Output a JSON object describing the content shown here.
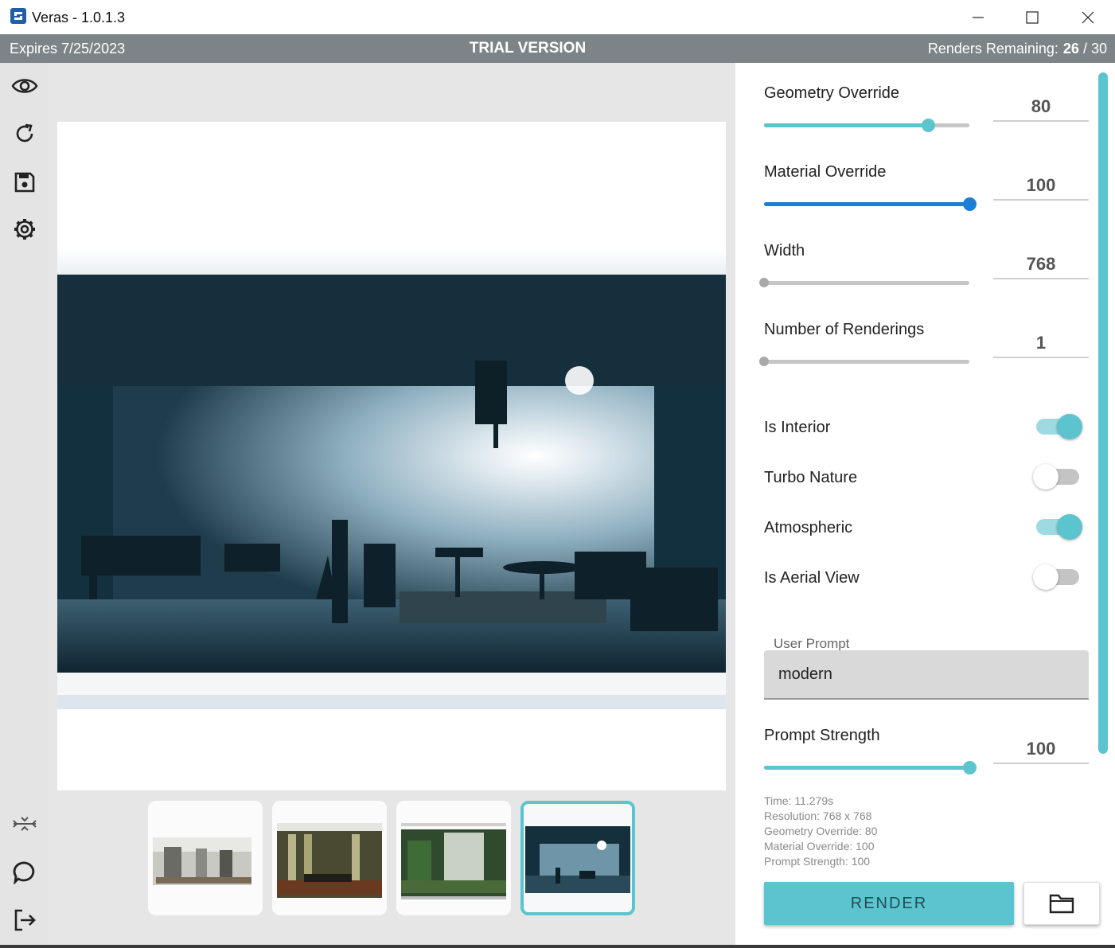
{
  "window": {
    "title": "Veras - 1.0.1.3"
  },
  "trial_bar": {
    "expires": "Expires 7/25/2023",
    "trial_label": "TRIAL VERSION",
    "remaining_label": "Renders Remaining:",
    "remaining_count": "26",
    "remaining_total": "/ 30"
  },
  "sidebar": {
    "top_icons": [
      "eye-icon",
      "refresh-icon",
      "save-icon",
      "gear-icon"
    ],
    "bottom_icons": [
      "collapse-icon",
      "chat-icon",
      "logout-icon"
    ]
  },
  "sliders": {
    "geometry": {
      "label": "Geometry Override",
      "value": "80",
      "fraction": 0.8,
      "color": "#5bc4cf"
    },
    "material": {
      "label": "Material Override",
      "value": "100",
      "fraction": 1.0,
      "color": "#1b7fd6"
    },
    "width": {
      "label": "Width",
      "value": "768",
      "fraction": 0.0,
      "color": "#c6c6c6"
    },
    "renderings": {
      "label": "Number of Renderings",
      "value": "1",
      "fraction": 0.0,
      "color": "#c6c6c6"
    },
    "strength": {
      "label": "Prompt Strength",
      "value": "100",
      "fraction": 1.0,
      "color": "#5bc4cf"
    }
  },
  "toggles": {
    "interior": {
      "label": "Is Interior",
      "on": true
    },
    "turbo": {
      "label": "Turbo Nature",
      "on": false
    },
    "atmospheric": {
      "label": "Atmospheric",
      "on": true
    },
    "aerial": {
      "label": "Is Aerial View",
      "on": false
    }
  },
  "prompt": {
    "label": "User Prompt",
    "value": "modern"
  },
  "info": {
    "time": "Time: 11.279s",
    "resolution": "Resolution: 768 x 768",
    "geometry": "Geometry Override: 80",
    "material": "Material Override: 100",
    "strength": "Prompt Strength: 100"
  },
  "actions": {
    "render": "RENDER"
  },
  "colors": {
    "accent": "#5bc4cf",
    "material_slider": "#1b7fd6",
    "trial_bar": "#7d8488"
  }
}
